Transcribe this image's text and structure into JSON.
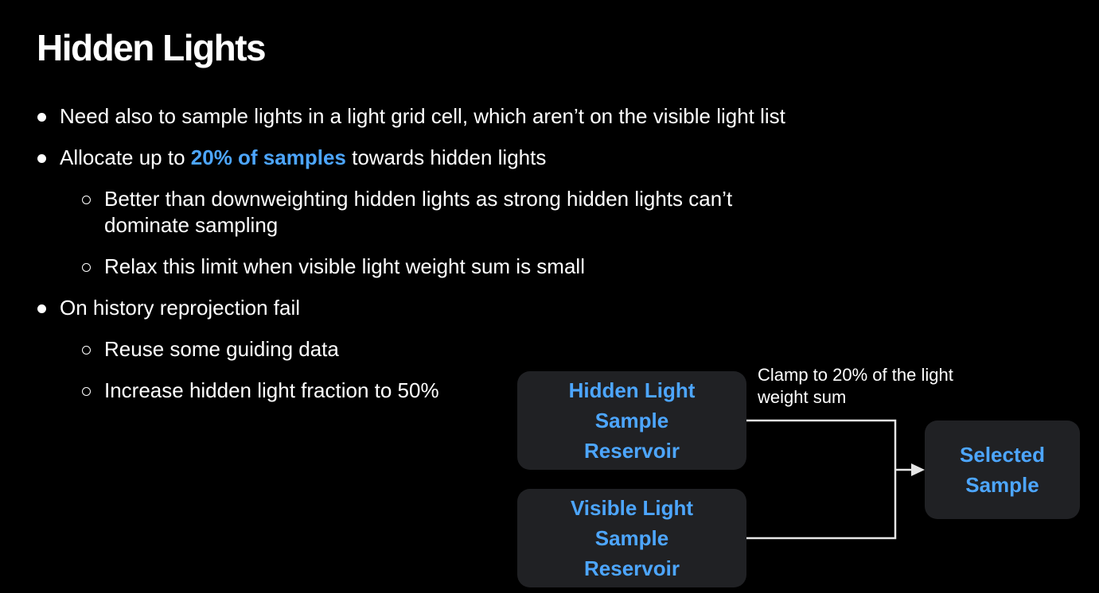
{
  "slide": {
    "title": "Hidden Lights",
    "bullets": [
      {
        "text": "Need also to sample lights in a light grid cell, which aren’t on the visible light list"
      },
      {
        "pre": "Allocate up to ",
        "highlight": "20% of samples",
        "post": " towards hidden lights"
      },
      {
        "text": "Better than downweighting hidden lights as strong hidden lights can’t dominate sampling"
      },
      {
        "text": "Relax this limit when visible light weight sum is small"
      },
      {
        "text": "On history reprojection fail"
      },
      {
        "text": "Reuse some guiding data"
      },
      {
        "text": "Increase hidden light fraction to 50%"
      }
    ]
  },
  "diagram": {
    "nodes": {
      "hidden": {
        "lines": [
          "Hidden Light",
          "Sample",
          "Reservoir"
        ]
      },
      "visible": {
        "lines": [
          "Visible Light",
          "Sample",
          "Reservoir"
        ]
      },
      "selected": {
        "lines": [
          "Selected",
          "Sample"
        ]
      }
    },
    "edge_label": "Clamp to 20% of the light weight sum"
  },
  "colors": {
    "background": "#000000",
    "text": "#ffffff",
    "accent": "#4da6ff",
    "node_fill": "#202124",
    "connector": "#e6e6e6"
  }
}
